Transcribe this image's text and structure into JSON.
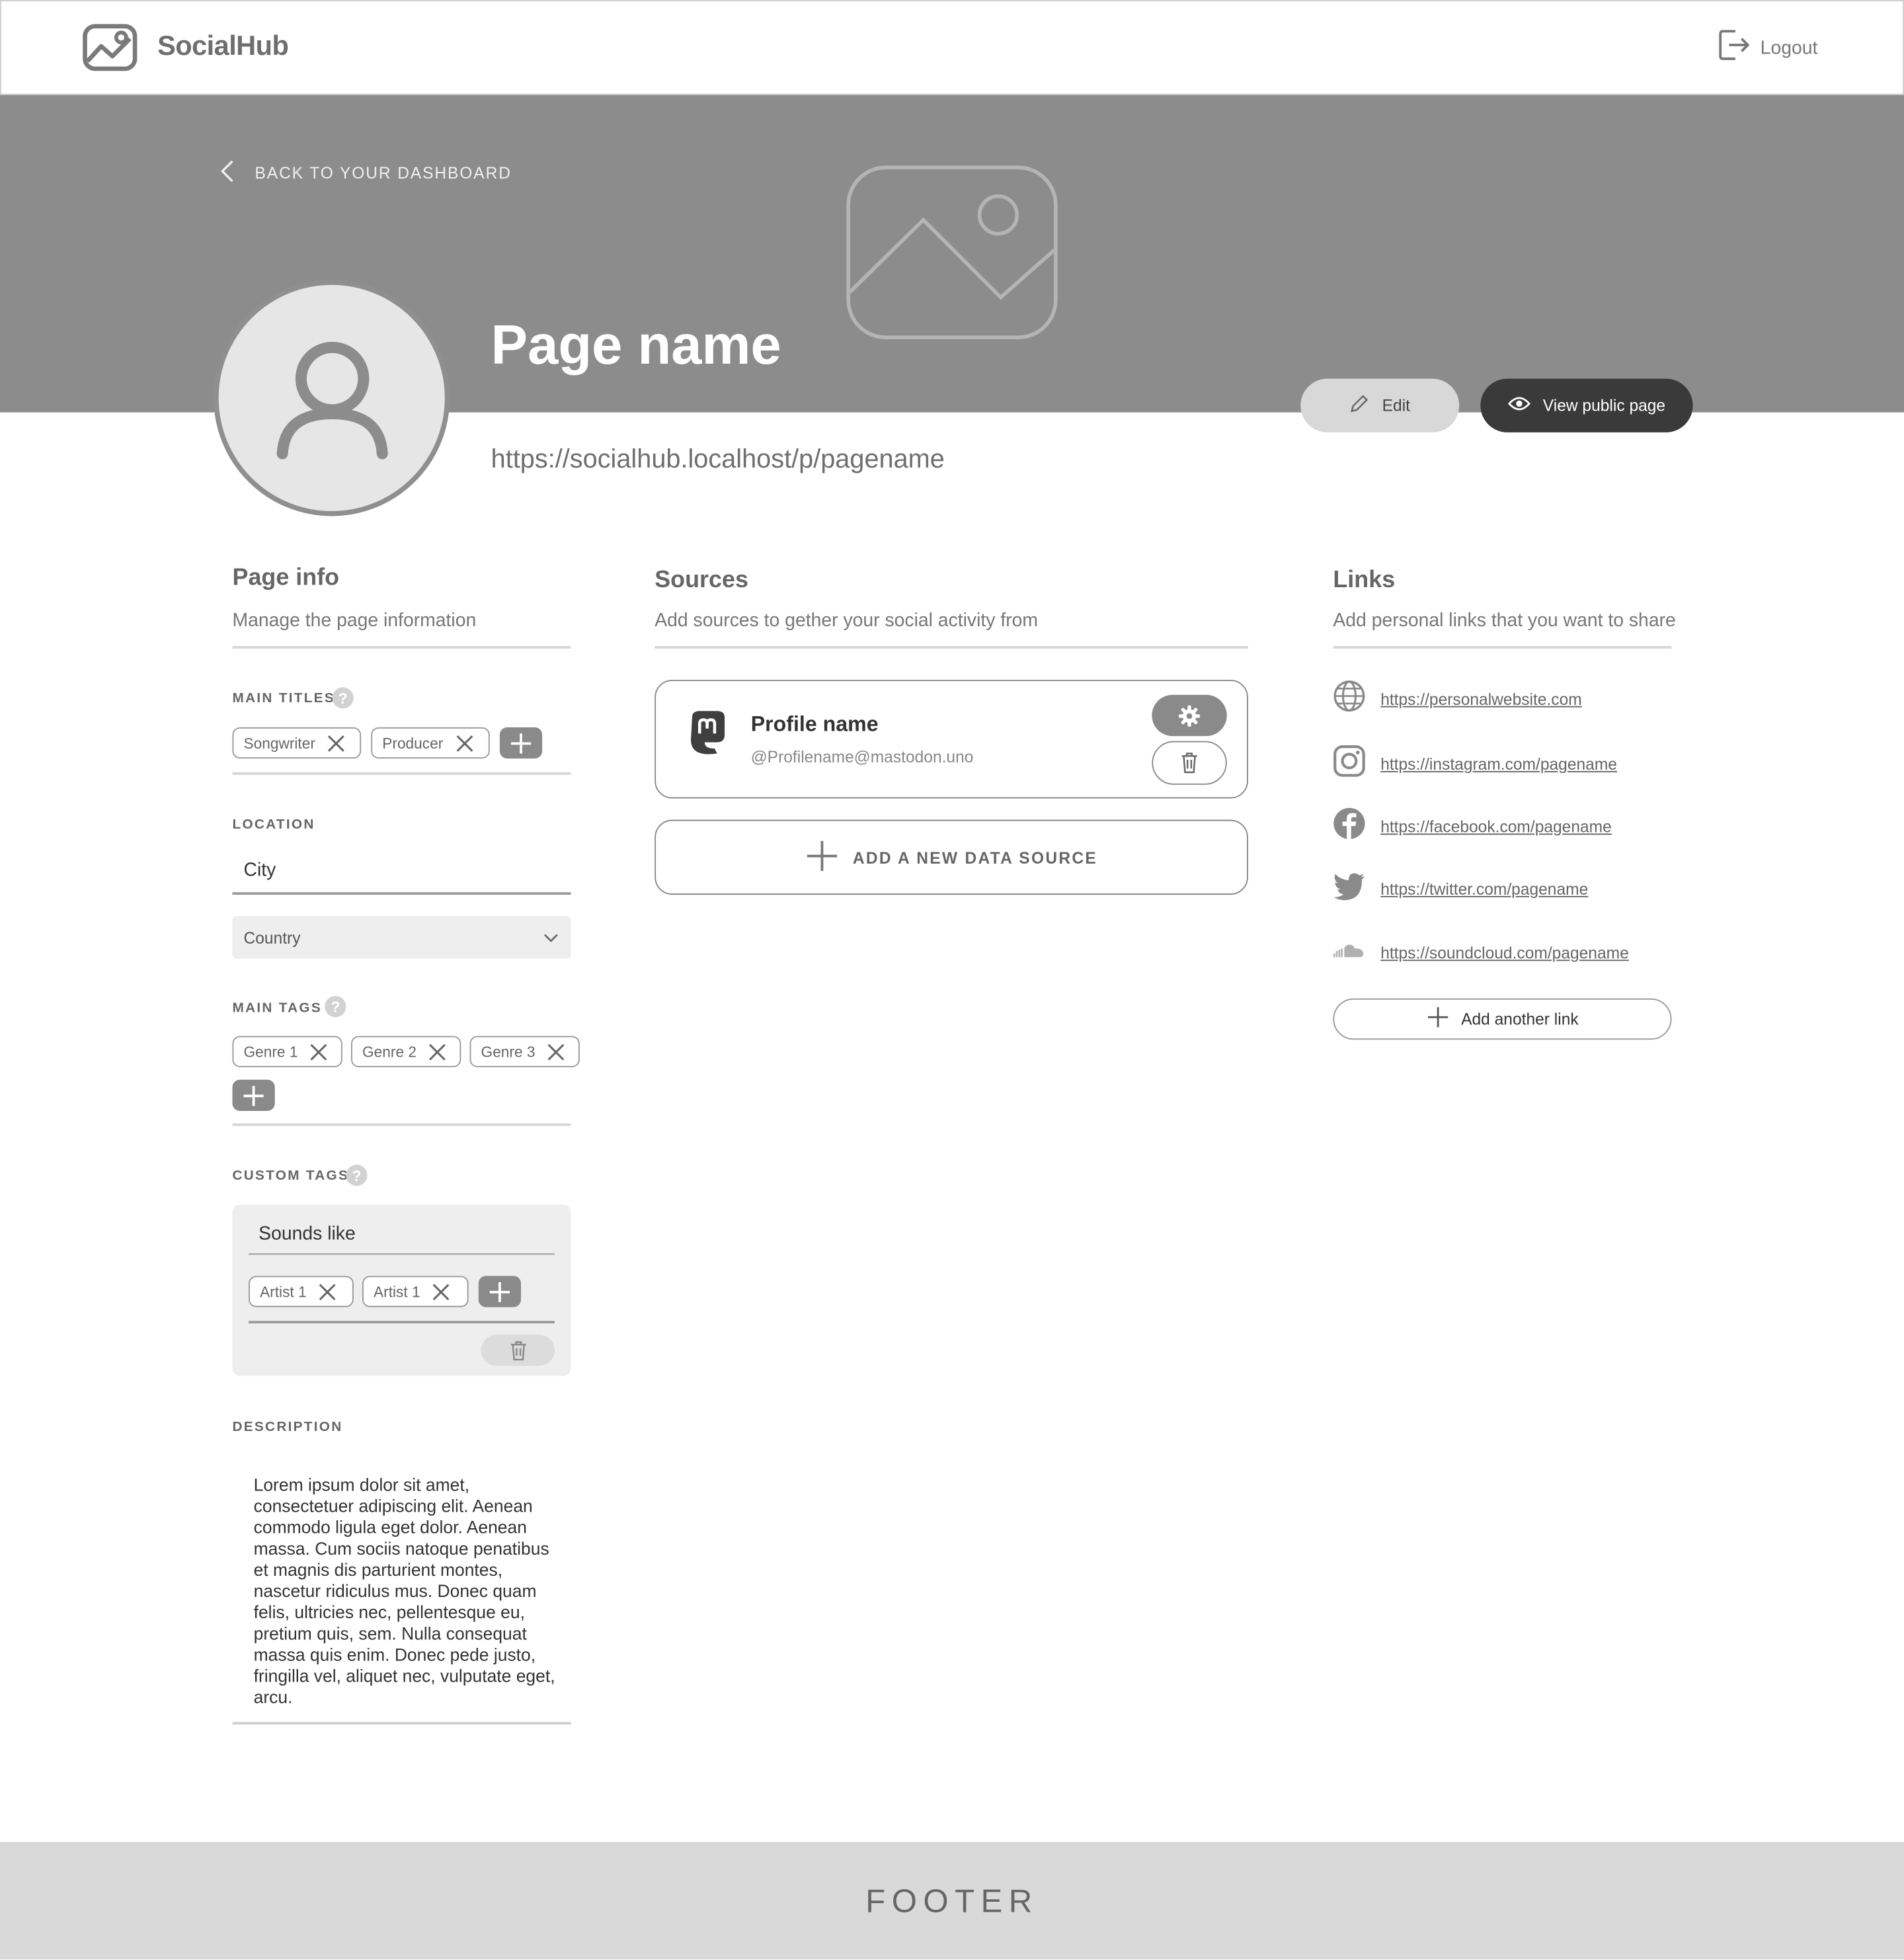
{
  "header": {
    "brand": "SocialHub",
    "logout_label": "Logout"
  },
  "banner": {
    "back_label": "BACK TO YOUR DASHBOARD",
    "page_name": "Page name",
    "page_url": "https://socialhub.localhost/p/pagename",
    "edit_label": "Edit",
    "view_label": "View public page"
  },
  "page_info": {
    "title": "Page info",
    "subtitle": "Manage the page information",
    "main_titles_label": "MAIN TITLES",
    "main_titles": [
      "Songwriter",
      "Producer"
    ],
    "location_label": "LOCATION",
    "city_value": "City",
    "country_value": "Country",
    "main_tags_label": "MAIN TAGS",
    "main_tags": [
      "Genre 1",
      "Genre 2",
      "Genre 3"
    ],
    "custom_tags_label": "CUSTOM TAGS",
    "custom_group_name": "Sounds like",
    "custom_group_tags": [
      "Artist 1",
      "Artist 1"
    ],
    "description_label": "DESCRIPTION",
    "description": "Lorem ipsum dolor sit amet, consectetuer adipiscing elit. Aenean commodo ligula eget dolor. Aenean massa. Cum sociis natoque penatibus et magnis dis parturient montes, nascetur ridiculus mus. Donec quam felis, ultricies nec, pellentesque eu, pretium quis, sem. Nulla consequat massa quis enim. Donec pede justo, fringilla vel, aliquet nec, vulputate eget, arcu."
  },
  "sources": {
    "title": "Sources",
    "subtitle": "Add sources to gether your social activity from",
    "card": {
      "profile_name": "Profile name",
      "handle": "@Profilename@mastodon.uno"
    },
    "add_label": "ADD A NEW DATA SOURCE"
  },
  "links": {
    "title": "Links",
    "subtitle": "Add personal links that you want to share",
    "items": [
      {
        "icon": "globe-icon",
        "url": "https://personalwebsite.com"
      },
      {
        "icon": "instagram-icon",
        "url": "https://instagram.com/pagename"
      },
      {
        "icon": "facebook-icon",
        "url": "https://facebook.com/pagename"
      },
      {
        "icon": "twitter-icon",
        "url": "https://twitter.com/pagename"
      },
      {
        "icon": "soundcloud-icon",
        "url": "https://soundcloud.com/pagename"
      }
    ],
    "add_label": "Add another link"
  },
  "footer": {
    "label": "FOOTER"
  },
  "colors": {
    "banner": "#8c8c8c",
    "dark_button": "#3a3a3a",
    "footer": "#d9d9d9"
  }
}
